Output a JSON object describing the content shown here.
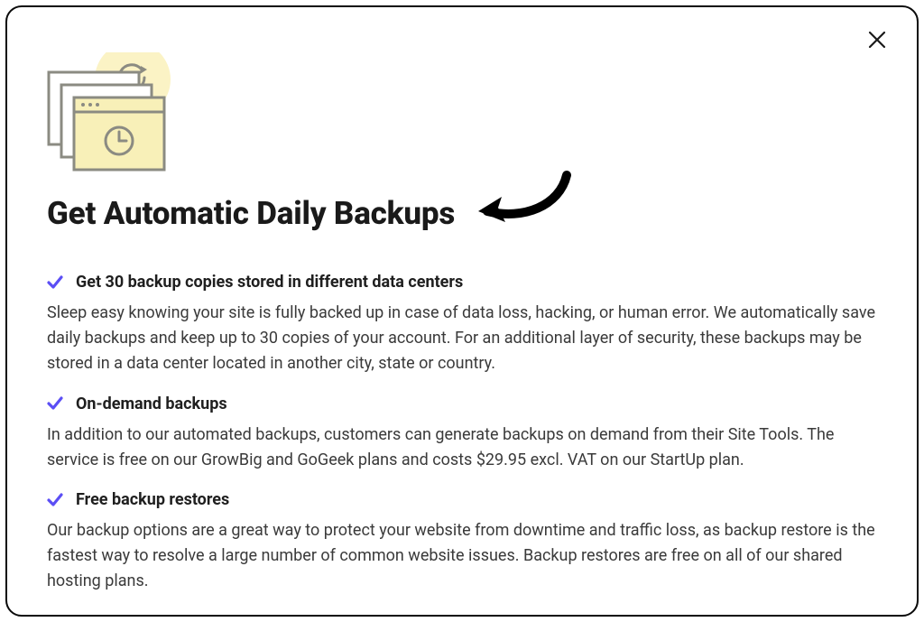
{
  "modal": {
    "title": "Get Automatic Daily Backups",
    "close_label": "Close",
    "features": [
      {
        "title": "Get 30 backup copies stored in different data centers",
        "body": "Sleep easy knowing your site is fully backed up in case of data loss, hacking, or human error. We automatically save daily backups and keep up to 30 copies of your account. For an additional layer of security, these backups may be stored in a data center located in another city, state or country."
      },
      {
        "title": "On-demand backups",
        "body": "In addition to our automated backups, customers can generate backups on demand from their Site Tools. The service is free on our GrowBig and GoGeek plans and costs $29.95 excl. VAT on our StartUp plan."
      },
      {
        "title": "Free backup restores",
        "body": "Our backup options are a great way to protect your website from downtime and traffic loss, as backup restore is the fastest way to resolve a large number of common website issues. Backup restores are free on all of our shared hosting plans."
      }
    ],
    "colors": {
      "check": "#5b4ef5",
      "illustration_accent": "#f8f0b8",
      "illustration_stroke": "#8a8a83",
      "arrow": "#000000"
    }
  }
}
